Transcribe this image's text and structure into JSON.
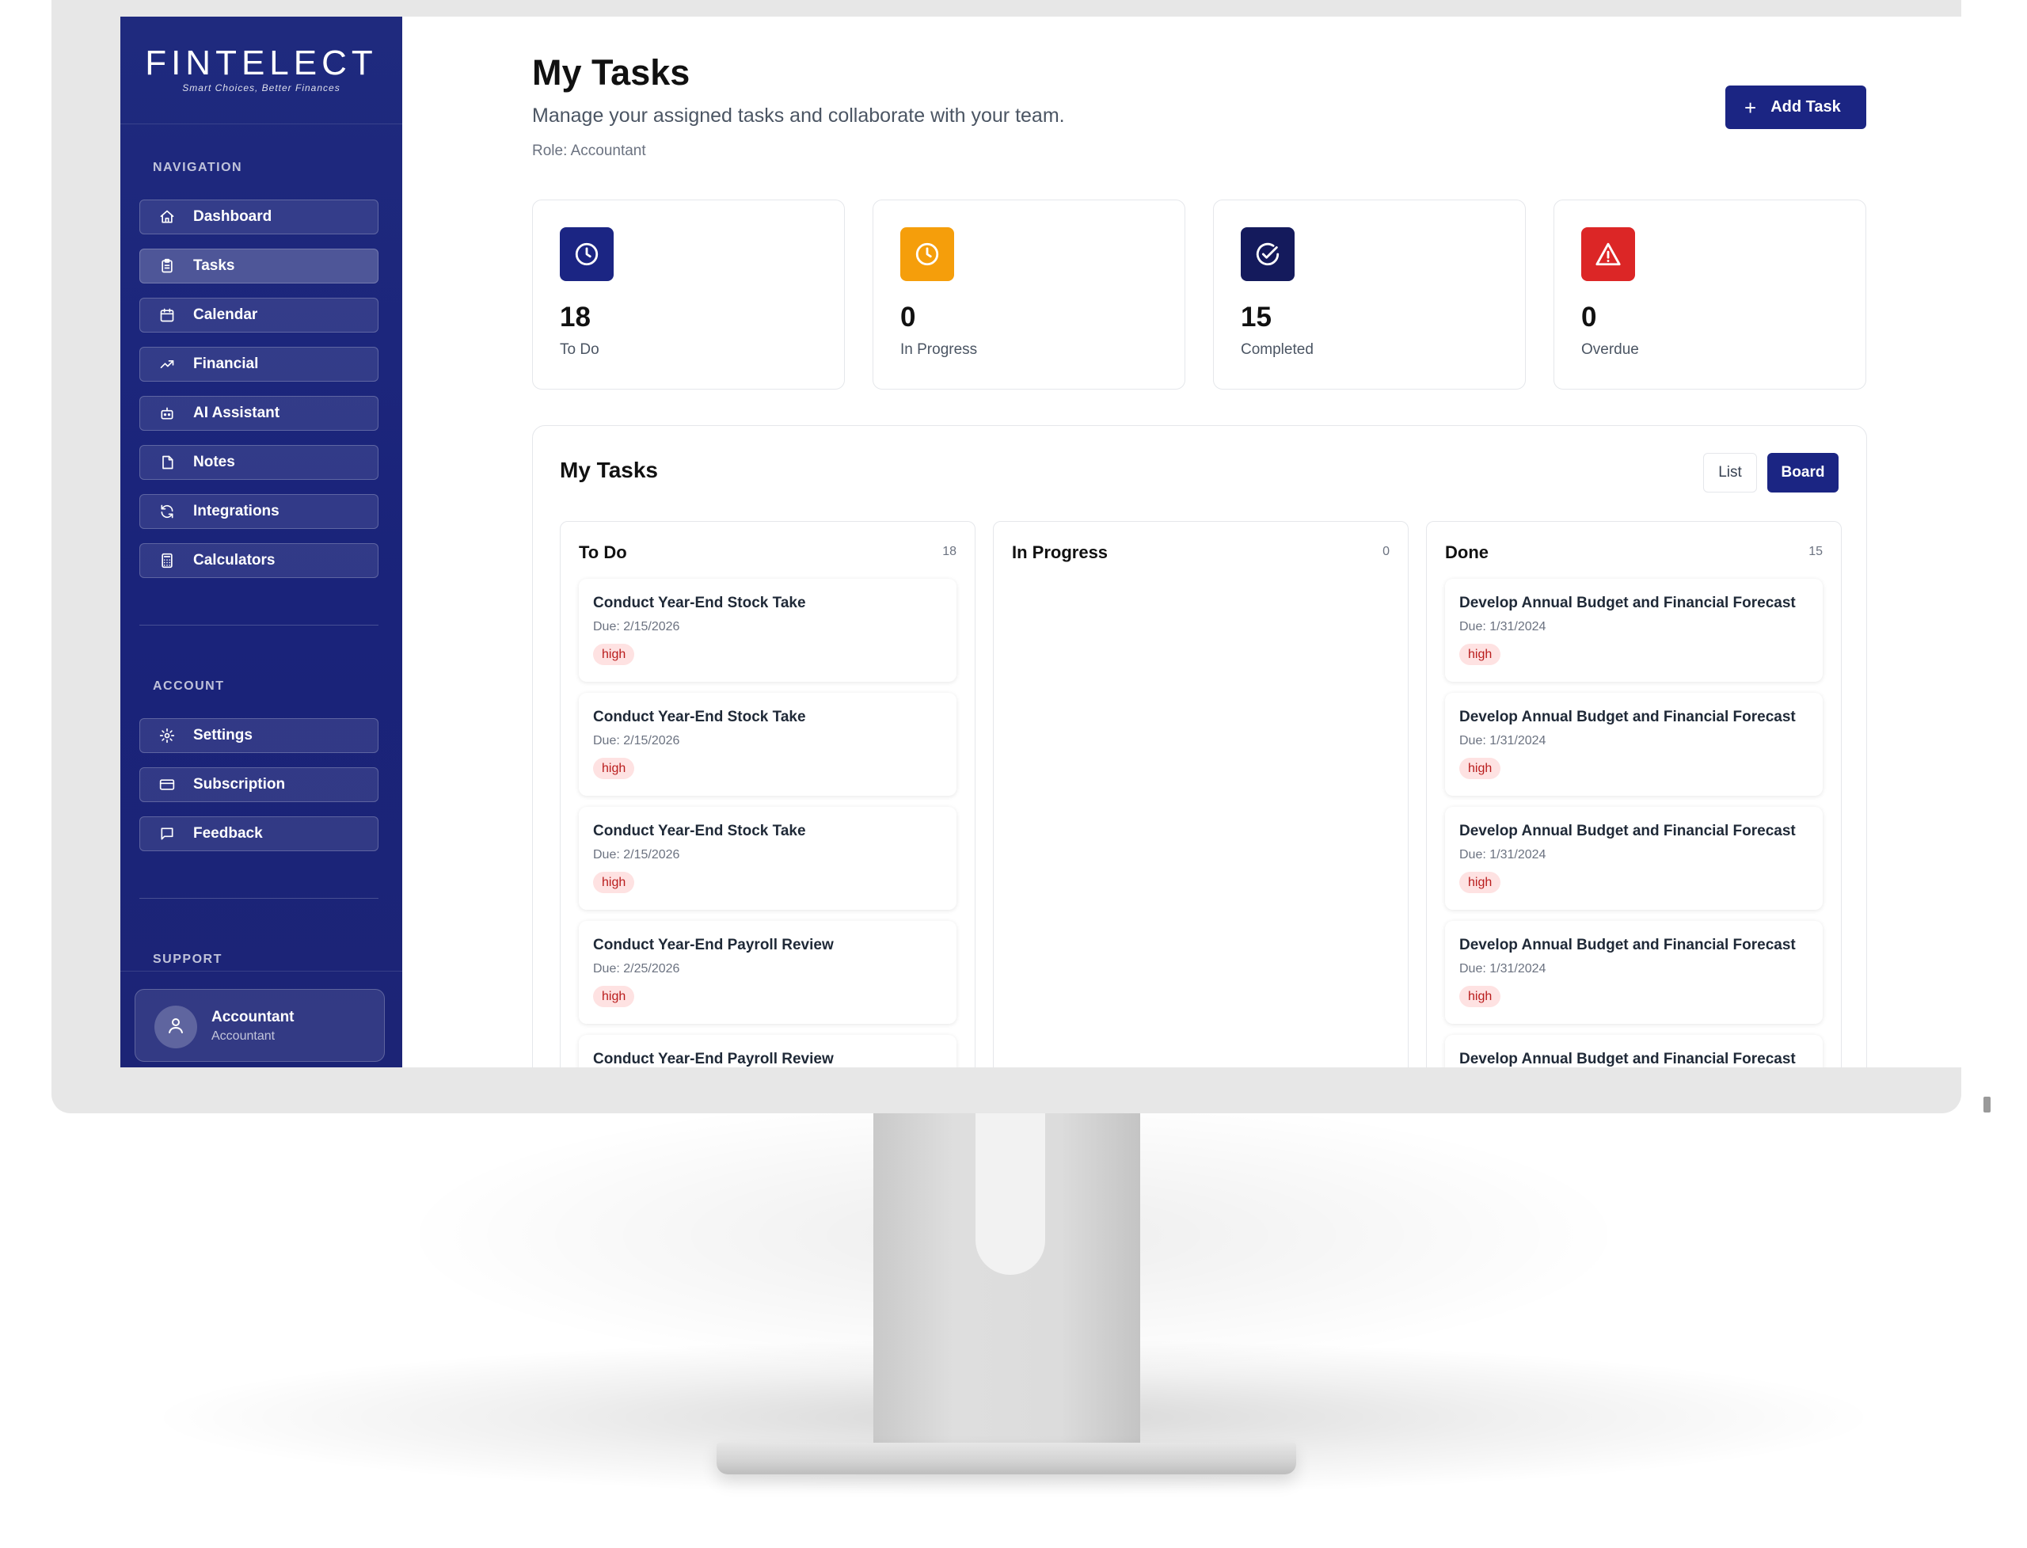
{
  "brand": {
    "name": "FINTELECT",
    "tagline": "Smart Choices, Better Finances"
  },
  "sidebar": {
    "navigation_label": "NAVIGATION",
    "nav_items": [
      {
        "label": "Dashboard",
        "icon": "home-icon"
      },
      {
        "label": "Tasks",
        "icon": "clipboard-icon",
        "active": true
      },
      {
        "label": "Calendar",
        "icon": "calendar-icon"
      },
      {
        "label": "Financial",
        "icon": "trending-up-icon"
      },
      {
        "label": "AI Assistant",
        "icon": "bot-icon"
      },
      {
        "label": "Notes",
        "icon": "note-icon"
      },
      {
        "label": "Integrations",
        "icon": "refresh-icon"
      },
      {
        "label": "Calculators",
        "icon": "calculator-icon"
      }
    ],
    "account_label": "ACCOUNT",
    "account_items": [
      {
        "label": "Settings",
        "icon": "gear-icon"
      },
      {
        "label": "Subscription",
        "icon": "credit-card-icon"
      },
      {
        "label": "Feedback",
        "icon": "message-icon"
      }
    ],
    "support_label": "SUPPORT",
    "user": {
      "name": "Accountant",
      "role": "Accountant",
      "icon": "user-icon"
    }
  },
  "header": {
    "title": "My Tasks",
    "subtitle": "Manage your assigned tasks and collaborate with your team.",
    "role_line": "Role: Accountant",
    "add_button": {
      "label": "Add Task",
      "icon": "plus-icon"
    }
  },
  "stats": [
    {
      "value": "18",
      "label": "To Do",
      "color": "#1b2583",
      "icon": "clock-icon"
    },
    {
      "value": "0",
      "label": "In Progress",
      "color": "#f59e0b",
      "icon": "clock-icon"
    },
    {
      "value": "15",
      "label": "Completed",
      "color": "#141a5c",
      "icon": "check-circle-icon"
    },
    {
      "value": "0",
      "label": "Overdue",
      "color": "#dc2626",
      "icon": "warning-icon"
    }
  ],
  "tasks_panel": {
    "title": "My Tasks",
    "view_list": "List",
    "view_board": "Board",
    "columns": [
      {
        "title": "To Do",
        "count": "18",
        "cards": [
          {
            "title": "Conduct Year-End Stock Take",
            "due": "Due: 2/15/2026",
            "priority": "high"
          },
          {
            "title": "Conduct Year-End Stock Take",
            "due": "Due: 2/15/2026",
            "priority": "high"
          },
          {
            "title": "Conduct Year-End Stock Take",
            "due": "Due: 2/15/2026",
            "priority": "high"
          },
          {
            "title": "Conduct Year-End Payroll Review",
            "due": "Due: 2/25/2026",
            "priority": "high"
          },
          {
            "title": "Conduct Year-End Payroll Review",
            "due": "",
            "priority": ""
          }
        ]
      },
      {
        "title": "In Progress",
        "count": "0",
        "cards": []
      },
      {
        "title": "Done",
        "count": "15",
        "cards": [
          {
            "title": "Develop Annual Budget and Financial Forecast",
            "due": "Due: 1/31/2024",
            "priority": "high"
          },
          {
            "title": "Develop Annual Budget and Financial Forecast",
            "due": "Due: 1/31/2024",
            "priority": "high"
          },
          {
            "title": "Develop Annual Budget and Financial Forecast",
            "due": "Due: 1/31/2024",
            "priority": "high"
          },
          {
            "title": "Develop Annual Budget and Financial Forecast",
            "due": "Due: 1/31/2024",
            "priority": "high"
          },
          {
            "title": "Develop Annual Budget and Financial Forecast",
            "due": "",
            "priority": ""
          }
        ]
      }
    ]
  }
}
